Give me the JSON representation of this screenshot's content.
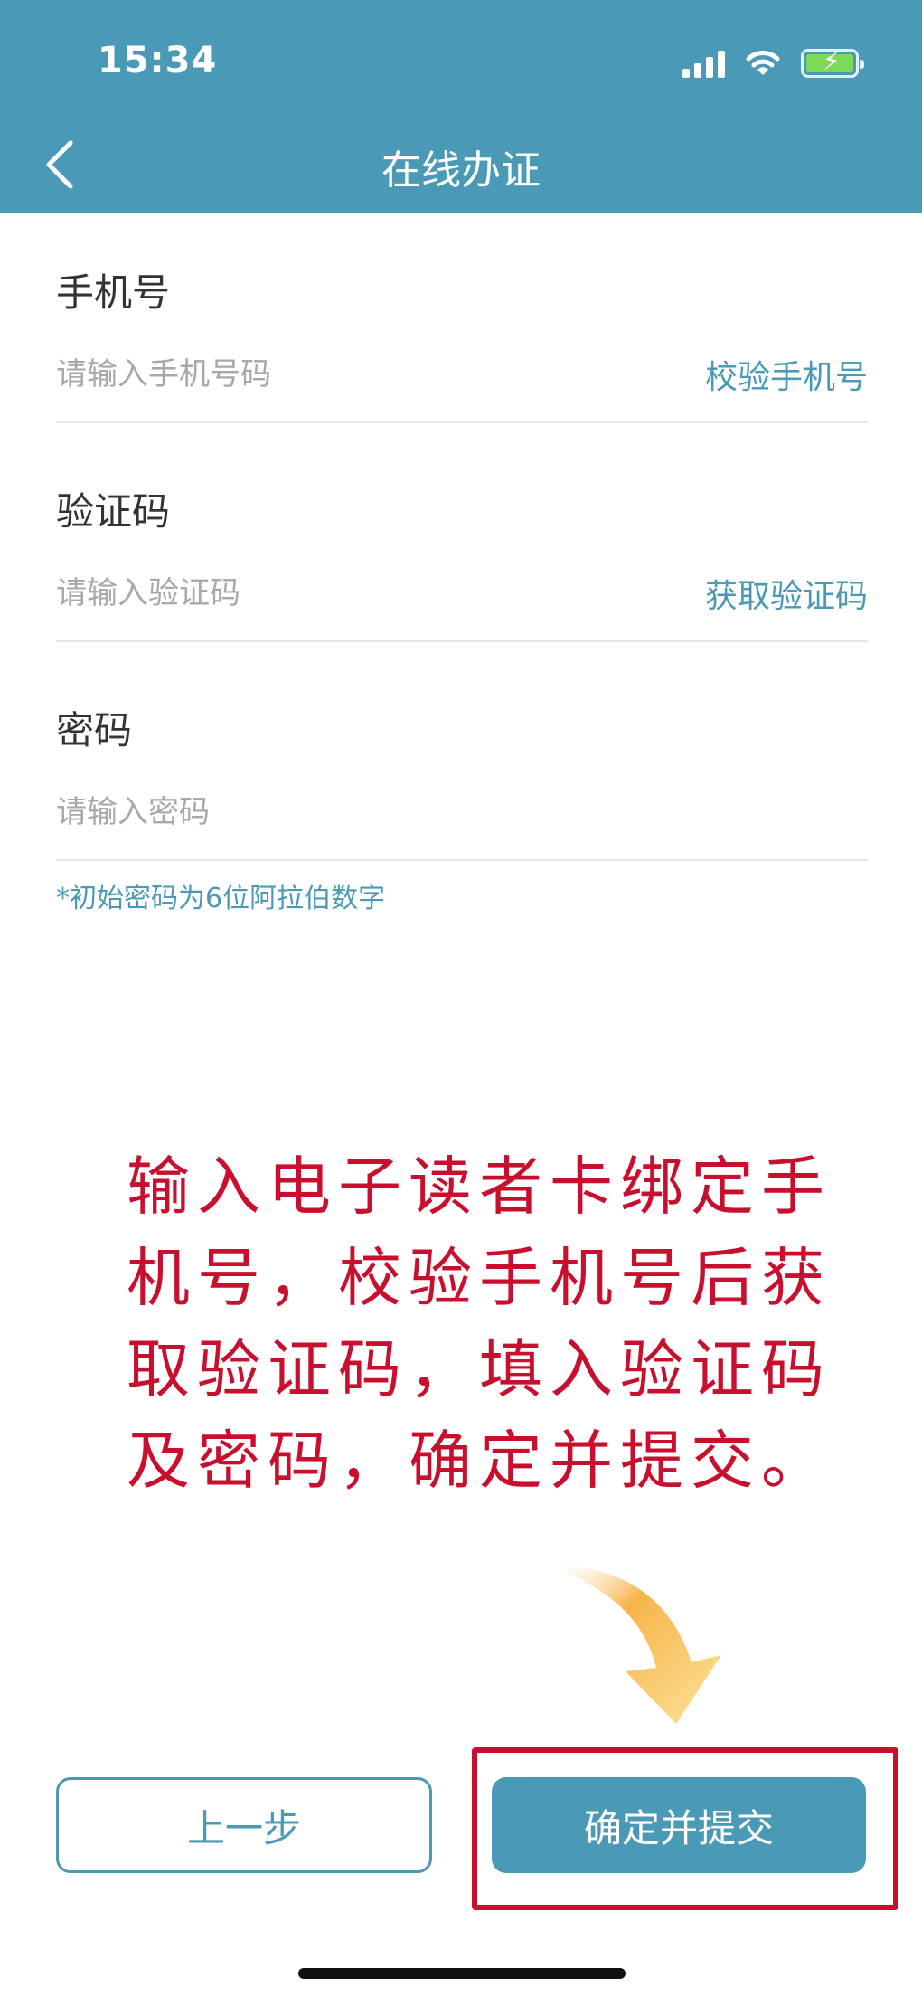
{
  "status_bar": {
    "time": "15:34"
  },
  "header": {
    "title": "在线办证"
  },
  "form": {
    "phone": {
      "label": "手机号",
      "placeholder": "请输入手机号码",
      "action": "校验手机号"
    },
    "code": {
      "label": "验证码",
      "placeholder": "请输入验证码",
      "action": "获取验证码"
    },
    "password": {
      "label": "密码",
      "placeholder": "请输入密码",
      "hint": "*初始密码为6位阿拉伯数字"
    }
  },
  "annotation": {
    "text": "输入电子读者卡绑定手机号，校验手机号后获取验证码，填入验证码及密码，确定并提交。",
    "color": "#c8102e"
  },
  "buttons": {
    "prev": "上一步",
    "submit": "确定并提交"
  },
  "colors": {
    "primary": "#4a9ab7",
    "highlight": "#c8102e"
  },
  "icons": [
    "back-chevron-icon",
    "signal-icon",
    "wifi-icon",
    "battery-charging-icon",
    "arrow-down-icon"
  ]
}
